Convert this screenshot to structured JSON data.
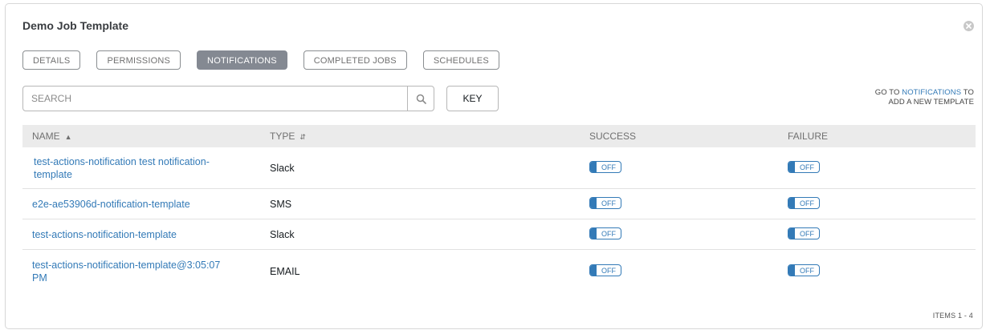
{
  "panel": {
    "title": "Demo Job Template"
  },
  "tabs": [
    {
      "label": "DETAILS",
      "active": false
    },
    {
      "label": "PERMISSIONS",
      "active": false
    },
    {
      "label": "NOTIFICATIONS",
      "active": true
    },
    {
      "label": "COMPLETED JOBS",
      "active": false
    },
    {
      "label": "SCHEDULES",
      "active": false
    }
  ],
  "search": {
    "placeholder": "SEARCH",
    "value": ""
  },
  "key_button": "KEY",
  "goto_hint": {
    "prefix": "GO TO ",
    "link": "NOTIFICATIONS",
    "suffix": " TO",
    "line2": "ADD A NEW TEMPLATE"
  },
  "table": {
    "headers": {
      "name": "NAME",
      "type": "TYPE",
      "success": "SUCCESS",
      "failure": "FAILURE"
    },
    "rows": [
      {
        "name": "test-actions-notification test notification-template",
        "type": "Slack",
        "success": "OFF",
        "failure": "OFF"
      },
      {
        "name": "e2e-ae53906d-notification-template",
        "type": "SMS",
        "success": "OFF",
        "failure": "OFF"
      },
      {
        "name": "test-actions-notification-template",
        "type": "Slack",
        "success": "OFF",
        "failure": "OFF"
      },
      {
        "name": "test-actions-notification-template@3:05:07 PM",
        "type": "EMAIL",
        "success": "OFF",
        "failure": "OFF"
      }
    ]
  },
  "pagination": {
    "items_label": "ITEMS 1 - 4"
  },
  "colors": {
    "link": "#337ab7",
    "active_tab": "#848992",
    "header_bg": "#ebebeb"
  },
  "icons": {
    "close": "close-icon",
    "search": "search-icon",
    "sort_name": "sort-asc-icon",
    "sort_type": "sort-both-icon"
  }
}
